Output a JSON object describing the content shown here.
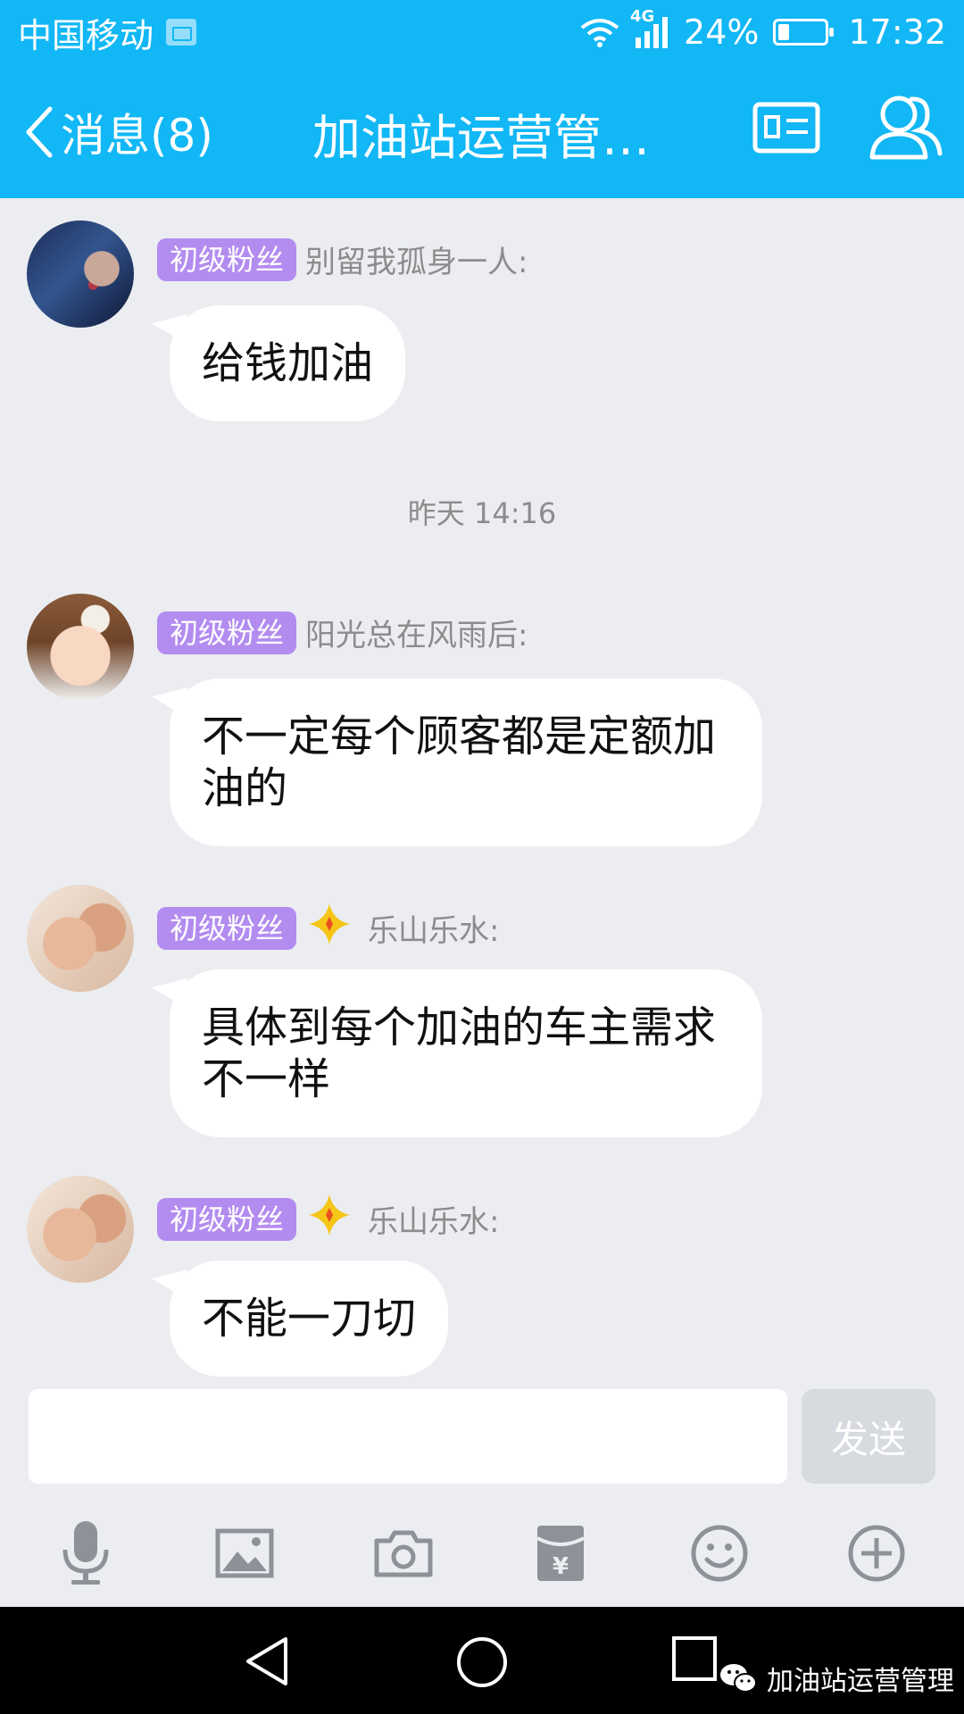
{
  "status_bar": {
    "carrier": "中国移动",
    "network": "4G",
    "battery": "24%",
    "battery_level": 0.24,
    "time": "17:32"
  },
  "header": {
    "back_label": "消息(8)",
    "title": "加油站运营管…"
  },
  "messages": [
    {
      "badge": "初级粉丝",
      "sender": "别留我孤身一人:",
      "star": false,
      "text": "给钱加油",
      "avatar": "woman-portrait"
    },
    {
      "badge": "初级粉丝",
      "sender": "阳光总在风雨后:",
      "star": false,
      "text": "不一定每个顾客都是定额加油的",
      "avatar": "baby-portrait"
    },
    {
      "badge": "初级粉丝",
      "sender": "乐山乐水:",
      "star": true,
      "text": "具体到每个加油的车主需求不一样",
      "avatar": "hands-photo"
    },
    {
      "badge": "初级粉丝",
      "sender": "乐山乐水:",
      "star": true,
      "text": "不能一刀切",
      "avatar": "hands-photo"
    }
  ],
  "timestamp": "昨天 14:16",
  "composer": {
    "value": "",
    "send_label": "发送"
  },
  "toolbar_icons": [
    "microphone-icon",
    "image-icon",
    "camera-icon",
    "red-packet-icon",
    "emoji-icon",
    "plus-icon"
  ],
  "watermark": "加油站运营管理",
  "colors": {
    "accent": "#12b7f5",
    "badge": "#b38cf0",
    "background": "#ebedf1",
    "star": "#f5c518"
  }
}
